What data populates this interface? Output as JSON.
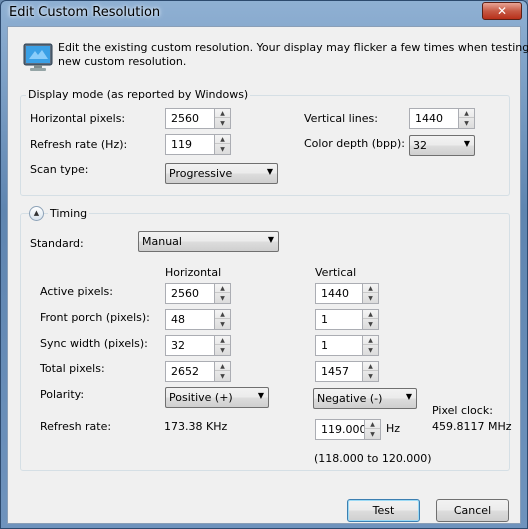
{
  "window": {
    "title": "Edit Custom Resolution",
    "close_glyph": "✕"
  },
  "intro_text": "Edit the existing custom resolution. Your display may flicker a few times when testing a new custom resolution.",
  "intro_line1": "Edit the existing custom resolution. Your display may flicker a few times when testing a",
  "intro_line2": "new custom resolution.",
  "display_mode": {
    "group_label": "Display mode (as reported by Windows)",
    "horizontal_pixels": {
      "label": "Horizontal pixels:",
      "value": "2560"
    },
    "refresh_rate": {
      "label": "Refresh rate (Hz):",
      "value": "119"
    },
    "scan_type": {
      "label": "Scan type:",
      "value": "Progressive"
    },
    "vertical_lines": {
      "label": "Vertical lines:",
      "value": "1440"
    },
    "color_depth": {
      "label": "Color depth (bpp):",
      "value": "32"
    }
  },
  "timing": {
    "label": "Timing",
    "standard_label": "Standard:",
    "standard_value": "Manual",
    "col_horizontal": "Horizontal",
    "col_vertical": "Vertical",
    "rows": {
      "active": {
        "label": "Active pixels:",
        "h": "2560",
        "v": "1440"
      },
      "front_porch": {
        "label": "Front porch (pixels):",
        "h": "48",
        "v": "1"
      },
      "sync_width": {
        "label": "Sync width (pixels):",
        "h": "32",
        "v": "1"
      },
      "total": {
        "label": "Total pixels:",
        "h": "2652",
        "v": "1457"
      }
    },
    "polarity": {
      "label": "Polarity:",
      "h": "Positive (+)",
      "v": "Negative (-)"
    },
    "refresh": {
      "label": "Refresh rate:",
      "h": "173.38 KHz",
      "v": "119.000",
      "unit": "Hz",
      "range": "(118.000 to 120.000)"
    },
    "pixel_clock": {
      "label": "Pixel clock:",
      "value": "459.8117 MHz"
    }
  },
  "buttons": {
    "test": "Test",
    "cancel": "Cancel"
  }
}
